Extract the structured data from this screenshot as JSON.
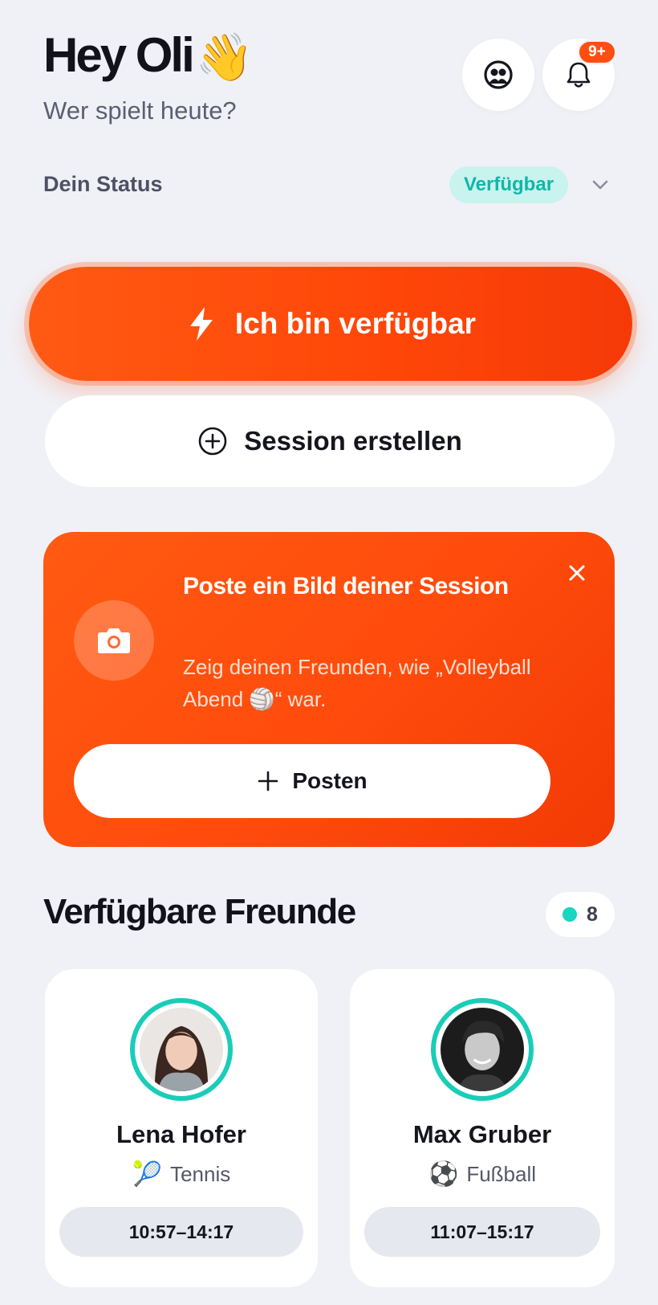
{
  "header": {
    "greeting": "Hey Oli",
    "greeting_emoji": "👋",
    "subtitle": "Wer spielt heute?",
    "notifications_badge": "9+",
    "friends_icon": "friends-icon",
    "bell_icon": "bell-icon"
  },
  "status": {
    "label": "Dein Status",
    "value": "Verfügbar",
    "value_color": "#11b7a6"
  },
  "actions": {
    "available_label": "Ich bin verfügbar",
    "create_session_label": "Session erstellen"
  },
  "promo": {
    "title": "Poste ein Bild deiner Session",
    "text": "Zeig deinen Freunden, wie „Volleyball Abend 🏐“ war.",
    "post_label": "Posten",
    "accent": "#ff4b0c"
  },
  "friends": {
    "title": "Verfügbare Freunde",
    "count": "8",
    "items": [
      {
        "name": "Lena Hofer",
        "sport_emoji": "🎾",
        "sport": "Tennis",
        "time": "10:57–14:17"
      },
      {
        "name": "Max Gruber",
        "sport_emoji": "⚽",
        "sport": "Fußball",
        "time": "11:07–15:17"
      }
    ]
  }
}
